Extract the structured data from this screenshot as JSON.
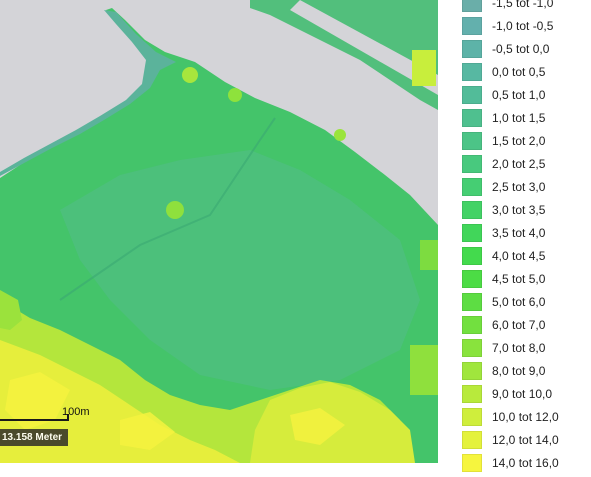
{
  "map": {
    "scale": {
      "label": "100m"
    },
    "measurement": {
      "text": "13.158 Meter"
    }
  },
  "legend": {
    "items": [
      {
        "label": "-1,5 tot -1,0",
        "color": "#6aaea9"
      },
      {
        "label": "-1,0 tot -0,5",
        "color": "#63b0ad"
      },
      {
        "label": "-0,5 tot 0,0",
        "color": "#5db3a8"
      },
      {
        "label": "0,0 tot 0,5",
        "color": "#57b8a2"
      },
      {
        "label": "0,5 tot 1,0",
        "color": "#52bc99"
      },
      {
        "label": "1,0 tot 1,5",
        "color": "#4fc08f"
      },
      {
        "label": "1,5 tot 2,0",
        "color": "#4cc487"
      },
      {
        "label": "2,0 tot 2,5",
        "color": "#48c97e"
      },
      {
        "label": "2,5 tot 3,0",
        "color": "#45ce73"
      },
      {
        "label": "3,0 tot 3,5",
        "color": "#43d266"
      },
      {
        "label": "3,5 tot 4,0",
        "color": "#41d65a"
      },
      {
        "label": "4,0 tot 4,5",
        "color": "#43da4d"
      },
      {
        "label": "4,5 tot 5,0",
        "color": "#4cdc45"
      },
      {
        "label": "5,0 tot 6,0",
        "color": "#5ddd43"
      },
      {
        "label": "6,0 tot 7,0",
        "color": "#72e03f"
      },
      {
        "label": "7,0 tot 8,0",
        "color": "#89e33d"
      },
      {
        "label": "8,0 tot 9,0",
        "color": "#a0e63d"
      },
      {
        "label": "9,0 tot 10,0",
        "color": "#b8ea3c"
      },
      {
        "label": "10,0 tot 12,0",
        "color": "#cfee3c"
      },
      {
        "label": "12,0 tot 14,0",
        "color": "#e4f23c"
      },
      {
        "label": "14,0 tot 16,0",
        "color": "#f6f53e"
      }
    ]
  }
}
